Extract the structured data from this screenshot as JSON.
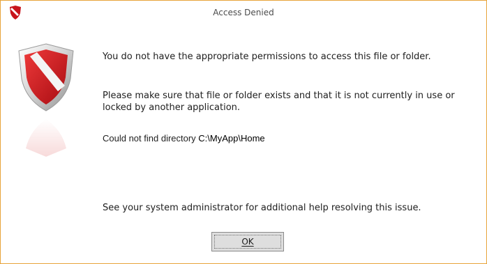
{
  "dialog": {
    "title": "Access Denied",
    "icon": "shield-icon",
    "messages": {
      "permission": "You do not have the appropriate permissions to access this file or folder.",
      "exists": "Please make sure that file or folder exists and that it is not currently in use or locked by another application.",
      "directory_prefix": "Could not find directory ",
      "directory_path": "C:\\MyApp\\Home",
      "help": "See your system administrator for additional help resolving this issue."
    },
    "ok_label": "OK"
  },
  "colors": {
    "accent_border": "#e8a33a",
    "shield_red": "#c8141c",
    "shield_white": "#f4f4f4",
    "button_bg": "#dedede"
  }
}
